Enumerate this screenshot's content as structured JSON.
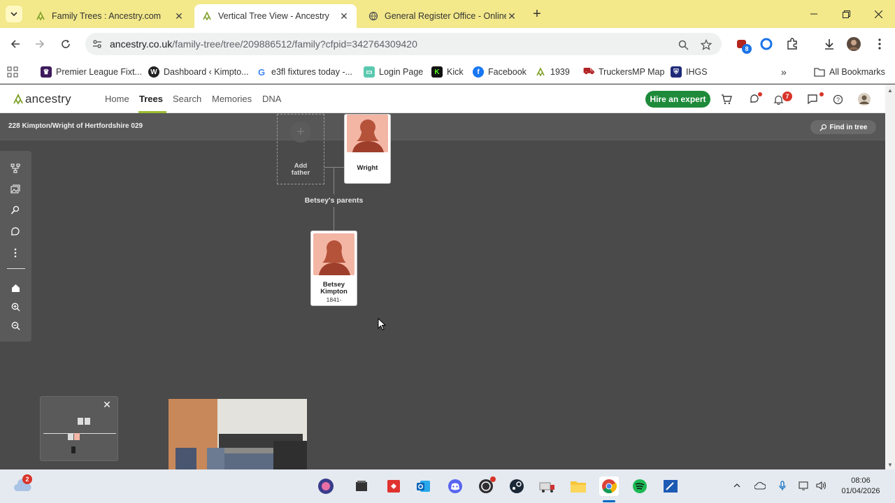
{
  "browser": {
    "tabs": [
      {
        "title": "Family Trees : Ancestry.com",
        "active": false
      },
      {
        "title": "Vertical Tree View - Ancestry",
        "active": true
      },
      {
        "title": "General Register Office - Online",
        "active": false
      }
    ],
    "url_host": "ancestry.co.uk",
    "url_path": "/family-tree/tree/209886512/family?cfpid=342764309420",
    "extension_badge": "8",
    "bookmarks": [
      {
        "label": "Premier League Fixt...",
        "icon": "premier-league-icon",
        "color": "#3d195b"
      },
      {
        "label": "Dashboard ‹ Kimpto...",
        "icon": "wordpress-icon",
        "color": "#222222"
      },
      {
        "label": "e3fl fixtures today -...",
        "icon": "google-icon",
        "color": "#4285f4"
      },
      {
        "label": "Login Page",
        "icon": "login-page-icon",
        "color": "#5bc8b0"
      },
      {
        "label": "Kick",
        "icon": "kick-icon",
        "color": "#53fc18"
      },
      {
        "label": "Facebook",
        "icon": "facebook-icon",
        "color": "#1877f2"
      },
      {
        "label": "1939",
        "icon": "ancestry-leaf-icon",
        "color": "#9cbe30"
      },
      {
        "label": "TruckersMP Map",
        "icon": "truck-icon",
        "color": "#b22222"
      },
      {
        "label": "IHGS",
        "icon": "shield-icon",
        "color": "#1e2a78"
      }
    ],
    "all_bookmarks_label": "All Bookmarks"
  },
  "ancestry": {
    "logo_text": "ancestry",
    "nav": [
      {
        "label": "Home"
      },
      {
        "label": "Trees"
      },
      {
        "label": "Search"
      },
      {
        "label": "Memories"
      },
      {
        "label": "DNA"
      }
    ],
    "hire_label": "Hire an expert",
    "notification_count": "7",
    "brand_green": "#1e8a3a",
    "accent_green": "#9cbe30"
  },
  "tree": {
    "title": "228 Kimpton/Wright of Hertfordshire 029",
    "find_label": "Find in tree",
    "add_father_label": "Add father",
    "mother_name": "Wright",
    "parents_label": "Betsey's parents",
    "person": {
      "name": "Betsey Kimpton",
      "name_line1": "Betsey",
      "name_line2": "Kimpton",
      "years": "1841-"
    }
  },
  "taskbar": {
    "notification_badge": "2",
    "time": "08:06",
    "date": "01/04/2026"
  }
}
